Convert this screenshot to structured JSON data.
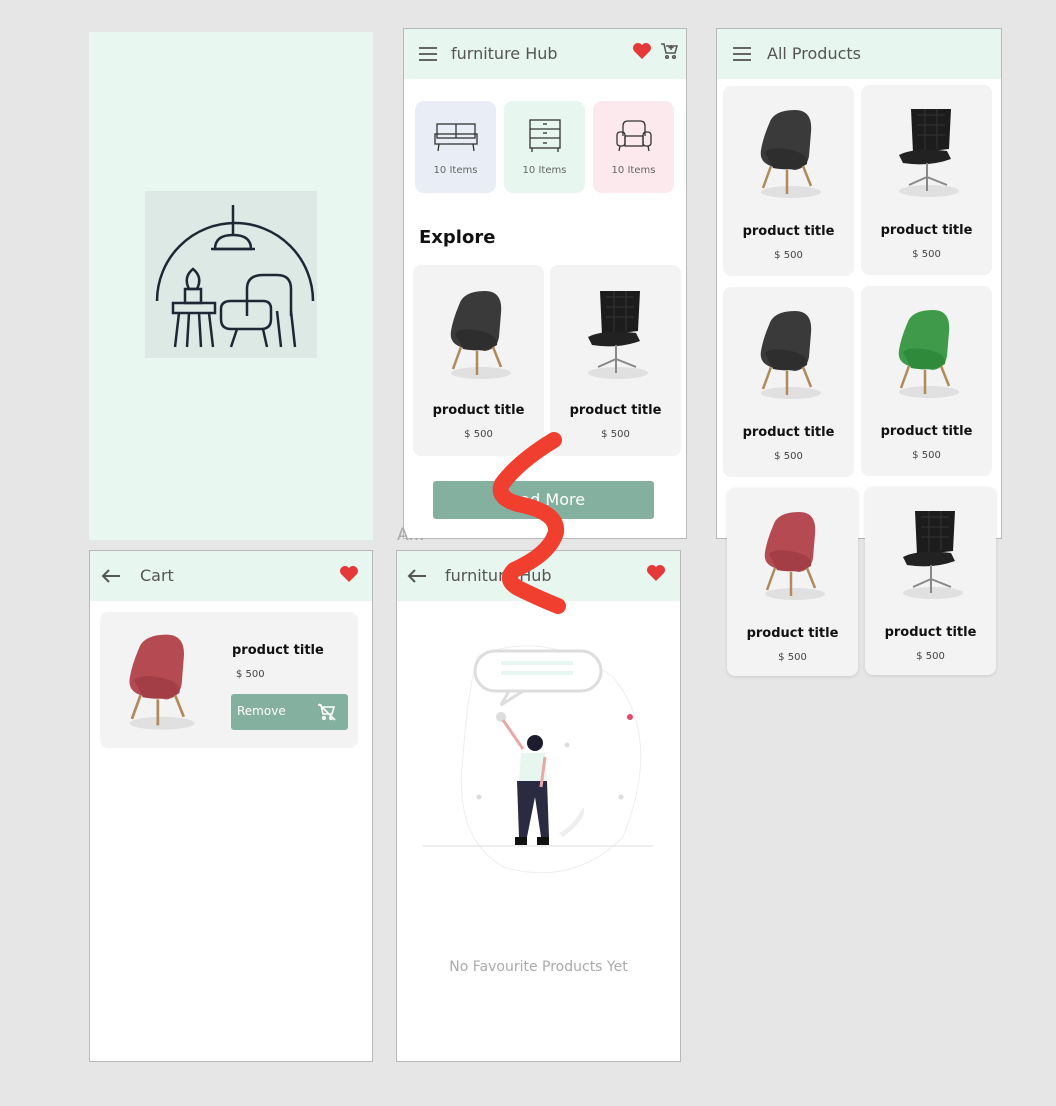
{
  "colors": {
    "mint": "#e7f6ef",
    "accent": "#84b09f",
    "heart": "#e53838",
    "squiggle": "#f03e2f"
  },
  "stray_label": "A...",
  "home": {
    "title": "furniture Hub",
    "categories": [
      {
        "icon": "sofa-icon",
        "count": "10 Items",
        "color": "#e9edf6"
      },
      {
        "icon": "dresser-icon",
        "count": "10 Items",
        "color": "#e7f6ef"
      },
      {
        "icon": "armchair-icon",
        "count": "10 Items",
        "color": "#fce9ee"
      }
    ],
    "explore": "Explore",
    "products": [
      {
        "title": "product title",
        "price": "$ 500"
      },
      {
        "title": "product title",
        "price": "$ 500"
      }
    ],
    "load_more": "Load More"
  },
  "all_products": {
    "title": "All Products",
    "products": [
      {
        "title": "product title",
        "price": "$ 500",
        "chair": "grey"
      },
      {
        "title": "product title",
        "price": "$ 500",
        "chair": "black"
      },
      {
        "title": "product title",
        "price": "$ 500",
        "chair": "grey"
      },
      {
        "title": "product title",
        "price": "$ 500",
        "chair": "green"
      },
      {
        "title": "product title",
        "price": "$ 500",
        "chair": "red"
      },
      {
        "title": "product title",
        "price": "$ 500",
        "chair": "black"
      }
    ]
  },
  "cart": {
    "title": "Cart",
    "item": {
      "title": "product title",
      "price": "$ 500"
    },
    "remove": "Remove"
  },
  "favourites": {
    "title": "furniture Hub",
    "empty": "No Favourite Products Yet"
  }
}
